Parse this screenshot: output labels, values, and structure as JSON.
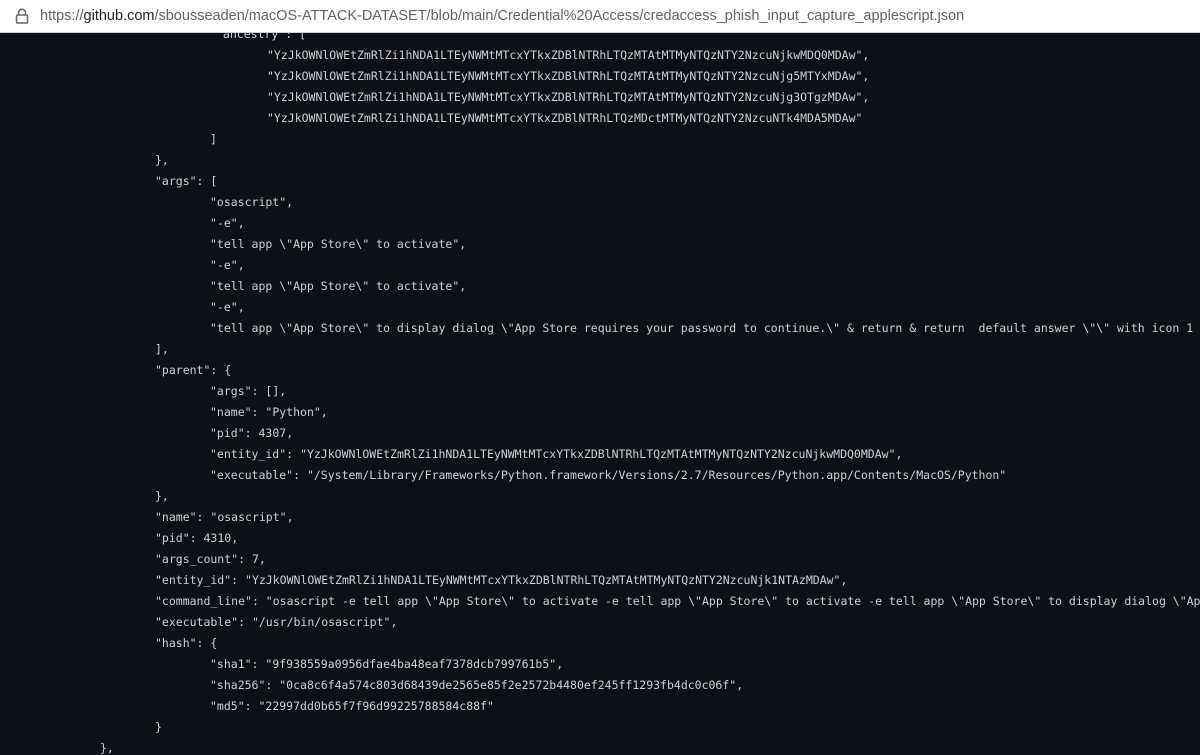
{
  "browser": {
    "url": {
      "scheme": "https://",
      "host": "github.com",
      "path": "/sbousseaden/macOS-ATTACK-DATASET/blob/main/Credential%20Access/credaccess_phish_input_capture_applescript.json"
    },
    "icon": "lock-icon"
  },
  "code_lines": [
    {
      "parts": [
        {
          "t": "\"ancestry\": [",
          "c": "p"
        }
      ]
    },
    {
      "parts": [
        {
          "t": "\"YzJkOWNlOWEtZmRlZi1hNDA1LTEyNWMtMTcxYTkxZDBlNTRhLTQzMTAtMTMyNTQzNTY2NzcuNjkwMDQ0MDAw\",",
          "c": "str"
        }
      ]
    },
    {
      "parts": [
        {
          "t": "\"YzJkOWNlOWEtZmRlZi1hNDA1LTEyNWMtMTcxYTkxZDBlNTRhLTQzMTAtMTMyNTQzNTY2NzcuNjg5MTYxMDAw\",",
          "c": "str"
        }
      ]
    },
    {
      "parts": [
        {
          "t": "\"YzJkOWNlOWEtZmRlZi1hNDA1LTEyNWMtMTcxYTkxZDBlNTRhLTQzMTAtMTMyNTQzNTY2NzcuNjg3OTgzMDAw\",",
          "c": "str"
        }
      ]
    },
    {
      "parts": [
        {
          "t": "\"YzJkOWNlOWEtZmRlZi1hNDA1LTEyNWMtMTcxYTkxZDBlNTRhLTQzMDctMTMyNTQzNTY2NzcuNTk4MDA5MDAw\"",
          "c": "str"
        }
      ]
    },
    {
      "parts": [
        {
          "t": "]",
          "c": "p"
        }
      ]
    },
    {
      "parts": [
        {
          "t": "},",
          "c": "p"
        }
      ]
    },
    {
      "parts": [
        {
          "t": "\"args\"",
          "c": "key"
        },
        {
          "t": ": [",
          "c": "p"
        }
      ]
    },
    {
      "parts": [
        {
          "t": "\"osascript\",",
          "c": "str"
        }
      ]
    },
    {
      "parts": [
        {
          "t": "\"-e\",",
          "c": "str"
        }
      ]
    },
    {
      "parts": [
        {
          "t": "\"tell app \\\"App Store\\\" to activate\",",
          "c": "str"
        }
      ]
    },
    {
      "parts": [
        {
          "t": "\"-e\",",
          "c": "str"
        }
      ]
    },
    {
      "parts": [
        {
          "t": "\"tell app \\\"App Store\\\" to activate\",",
          "c": "str"
        }
      ]
    },
    {
      "parts": [
        {
          "t": "\"-e\",",
          "c": "str"
        }
      ]
    },
    {
      "parts": [
        {
          "t": "\"tell app \\\"App Store\\\" to display dialog \\\"App Store requires your password to continue.\\\" & return & return  default answer \\\"\\\" with icon 1",
          "c": "str"
        }
      ]
    },
    {
      "parts": [
        {
          "t": "],",
          "c": "p"
        }
      ]
    },
    {
      "parts": [
        {
          "t": "\"parent\"",
          "c": "key"
        },
        {
          "t": ": {",
          "c": "p"
        }
      ]
    },
    {
      "parts": [
        {
          "t": "\"args\"",
          "c": "key"
        },
        {
          "t": ": [],",
          "c": "p"
        }
      ]
    },
    {
      "parts": [
        {
          "t": "\"name\"",
          "c": "key"
        },
        {
          "t": ": ",
          "c": "p"
        },
        {
          "t": "\"Python\"",
          "c": "str"
        },
        {
          "t": ",",
          "c": "p"
        }
      ]
    },
    {
      "parts": [
        {
          "t": "\"pid\"",
          "c": "key"
        },
        {
          "t": ": ",
          "c": "p"
        },
        {
          "t": "4307",
          "c": "num"
        },
        {
          "t": ",",
          "c": "p"
        }
      ]
    },
    {
      "parts": [
        {
          "t": "\"entity_id\"",
          "c": "key"
        },
        {
          "t": ": ",
          "c": "p"
        },
        {
          "t": "\"YzJkOWNlOWEtZmRlZi1hNDA1LTEyNWMtMTcxYTkxZDBlNTRhLTQzMTAtMTMyNTQzNTY2NzcuNjkwMDQ0MDAw\"",
          "c": "str"
        },
        {
          "t": ",",
          "c": "p"
        }
      ]
    },
    {
      "parts": [
        {
          "t": "\"executable\"",
          "c": "key"
        },
        {
          "t": ": ",
          "c": "p"
        },
        {
          "t": "\"/System/Library/Frameworks/Python.framework/Versions/2.7/Resources/Python.app/Contents/MacOS/Python\"",
          "c": "str"
        }
      ]
    },
    {
      "parts": [
        {
          "t": "},",
          "c": "p"
        }
      ]
    },
    {
      "parts": [
        {
          "t": "\"name\"",
          "c": "key"
        },
        {
          "t": ": ",
          "c": "p"
        },
        {
          "t": "\"osascript\"",
          "c": "str"
        },
        {
          "t": ",",
          "c": "p"
        }
      ]
    },
    {
      "parts": [
        {
          "t": "\"pid\"",
          "c": "key"
        },
        {
          "t": ": ",
          "c": "p"
        },
        {
          "t": "4310",
          "c": "num"
        },
        {
          "t": ",",
          "c": "p"
        }
      ]
    },
    {
      "parts": [
        {
          "t": "\"args_count\"",
          "c": "key"
        },
        {
          "t": ": ",
          "c": "p"
        },
        {
          "t": "7",
          "c": "num"
        },
        {
          "t": ",",
          "c": "p"
        }
      ]
    },
    {
      "parts": [
        {
          "t": "\"entity_id\"",
          "c": "key"
        },
        {
          "t": ": ",
          "c": "p"
        },
        {
          "t": "\"YzJkOWNlOWEtZmRlZi1hNDA1LTEyNWMtMTcxYTkxZDBlNTRhLTQzMTAtMTMyNTQzNTY2NzcuNjk1NTAzMDAw\"",
          "c": "str"
        },
        {
          "t": ",",
          "c": "p"
        }
      ]
    },
    {
      "parts": [
        {
          "t": "\"command_line\"",
          "c": "key"
        },
        {
          "t": ": ",
          "c": "p"
        },
        {
          "t": "\"osascript -e tell app \\\"App Store\\\" to activate -e tell app \\\"App Store\\\" to activate -e tell app \\\"App Store\\\" to display dialog \\\"Ap",
          "c": "str"
        }
      ]
    },
    {
      "parts": [
        {
          "t": "\"executable\"",
          "c": "key"
        },
        {
          "t": ": ",
          "c": "p"
        },
        {
          "t": "\"/usr/bin/osascript\"",
          "c": "str"
        },
        {
          "t": ",",
          "c": "p"
        }
      ]
    },
    {
      "parts": [
        {
          "t": "\"hash\"",
          "c": "key"
        },
        {
          "t": ": {",
          "c": "p"
        }
      ]
    },
    {
      "parts": [
        {
          "t": "\"sha1\"",
          "c": "key"
        },
        {
          "t": ": ",
          "c": "p"
        },
        {
          "t": "\"9f938559a0956dfae4ba48eaf7378dcb799761b5\"",
          "c": "str"
        },
        {
          "t": ",",
          "c": "p"
        }
      ]
    },
    {
      "parts": [
        {
          "t": "\"sha256\"",
          "c": "key"
        },
        {
          "t": ": ",
          "c": "p"
        },
        {
          "t": "\"0ca8c6f4a574c803d68439de2565e85f2e2572b4480ef245ff1293fb4dc0c06f\"",
          "c": "str"
        },
        {
          "t": ",",
          "c": "p"
        }
      ]
    },
    {
      "parts": [
        {
          "t": "\"md5\"",
          "c": "key"
        },
        {
          "t": ": ",
          "c": "p"
        },
        {
          "t": "\"22997dd0b65f7f96d99225788584c88f\"",
          "c": "str"
        }
      ]
    },
    {
      "parts": [
        {
          "t": "}",
          "c": "p"
        }
      ]
    },
    {
      "parts": [
        {
          "t": "},",
          "c": "p"
        }
      ]
    }
  ]
}
